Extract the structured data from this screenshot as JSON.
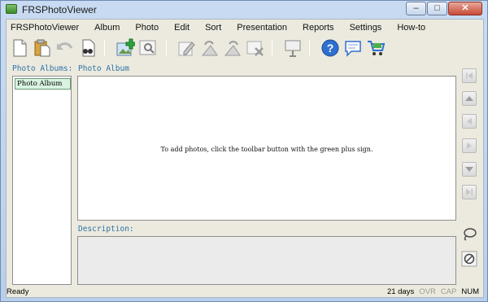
{
  "window": {
    "title": "FRSPhotoViewer",
    "icons": {
      "app": "app-icon",
      "minimize": "minimize-icon",
      "maximize": "maximize-icon",
      "close": "close-icon"
    }
  },
  "menu": [
    "FRSPhotoViewer",
    "Album",
    "Photo",
    "Edit",
    "Sort",
    "Presentation",
    "Reports",
    "Settings",
    "How-to"
  ],
  "toolbar": [
    "new-document-icon",
    "paste-icon",
    "undo-icon",
    "find-document-icon",
    "add-photo-icon",
    "zoom-photo-icon",
    "edit-icon",
    "rotate-left-icon",
    "rotate-right-icon",
    "delete-photo-icon",
    "presentation-icon",
    "help-icon",
    "comment-icon",
    "cart-icon"
  ],
  "labels": {
    "albums": "Photo Albums:",
    "photo": "Photo Album",
    "description": "Description:"
  },
  "albums": {
    "items": [
      "Photo Album"
    ],
    "selected": 0
  },
  "photo_area": {
    "hint": "To add photos, click the toolbar button with the green plus sign."
  },
  "side_nav": [
    "first-photo-icon",
    "previous-page-icon",
    "previous-photo-icon",
    "next-photo-icon",
    "next-page-icon",
    "last-photo-icon"
  ],
  "side_tools": [
    "lasso-icon",
    "no-entry-icon"
  ],
  "status": {
    "left": "Ready",
    "days": "21 days",
    "ovr": "OVR",
    "cap": "CAP",
    "num": "NUM"
  },
  "colors": {
    "label_blue": "#2c74a8",
    "selected_album": "#d8f3df",
    "panel_bg": "#eceade"
  }
}
